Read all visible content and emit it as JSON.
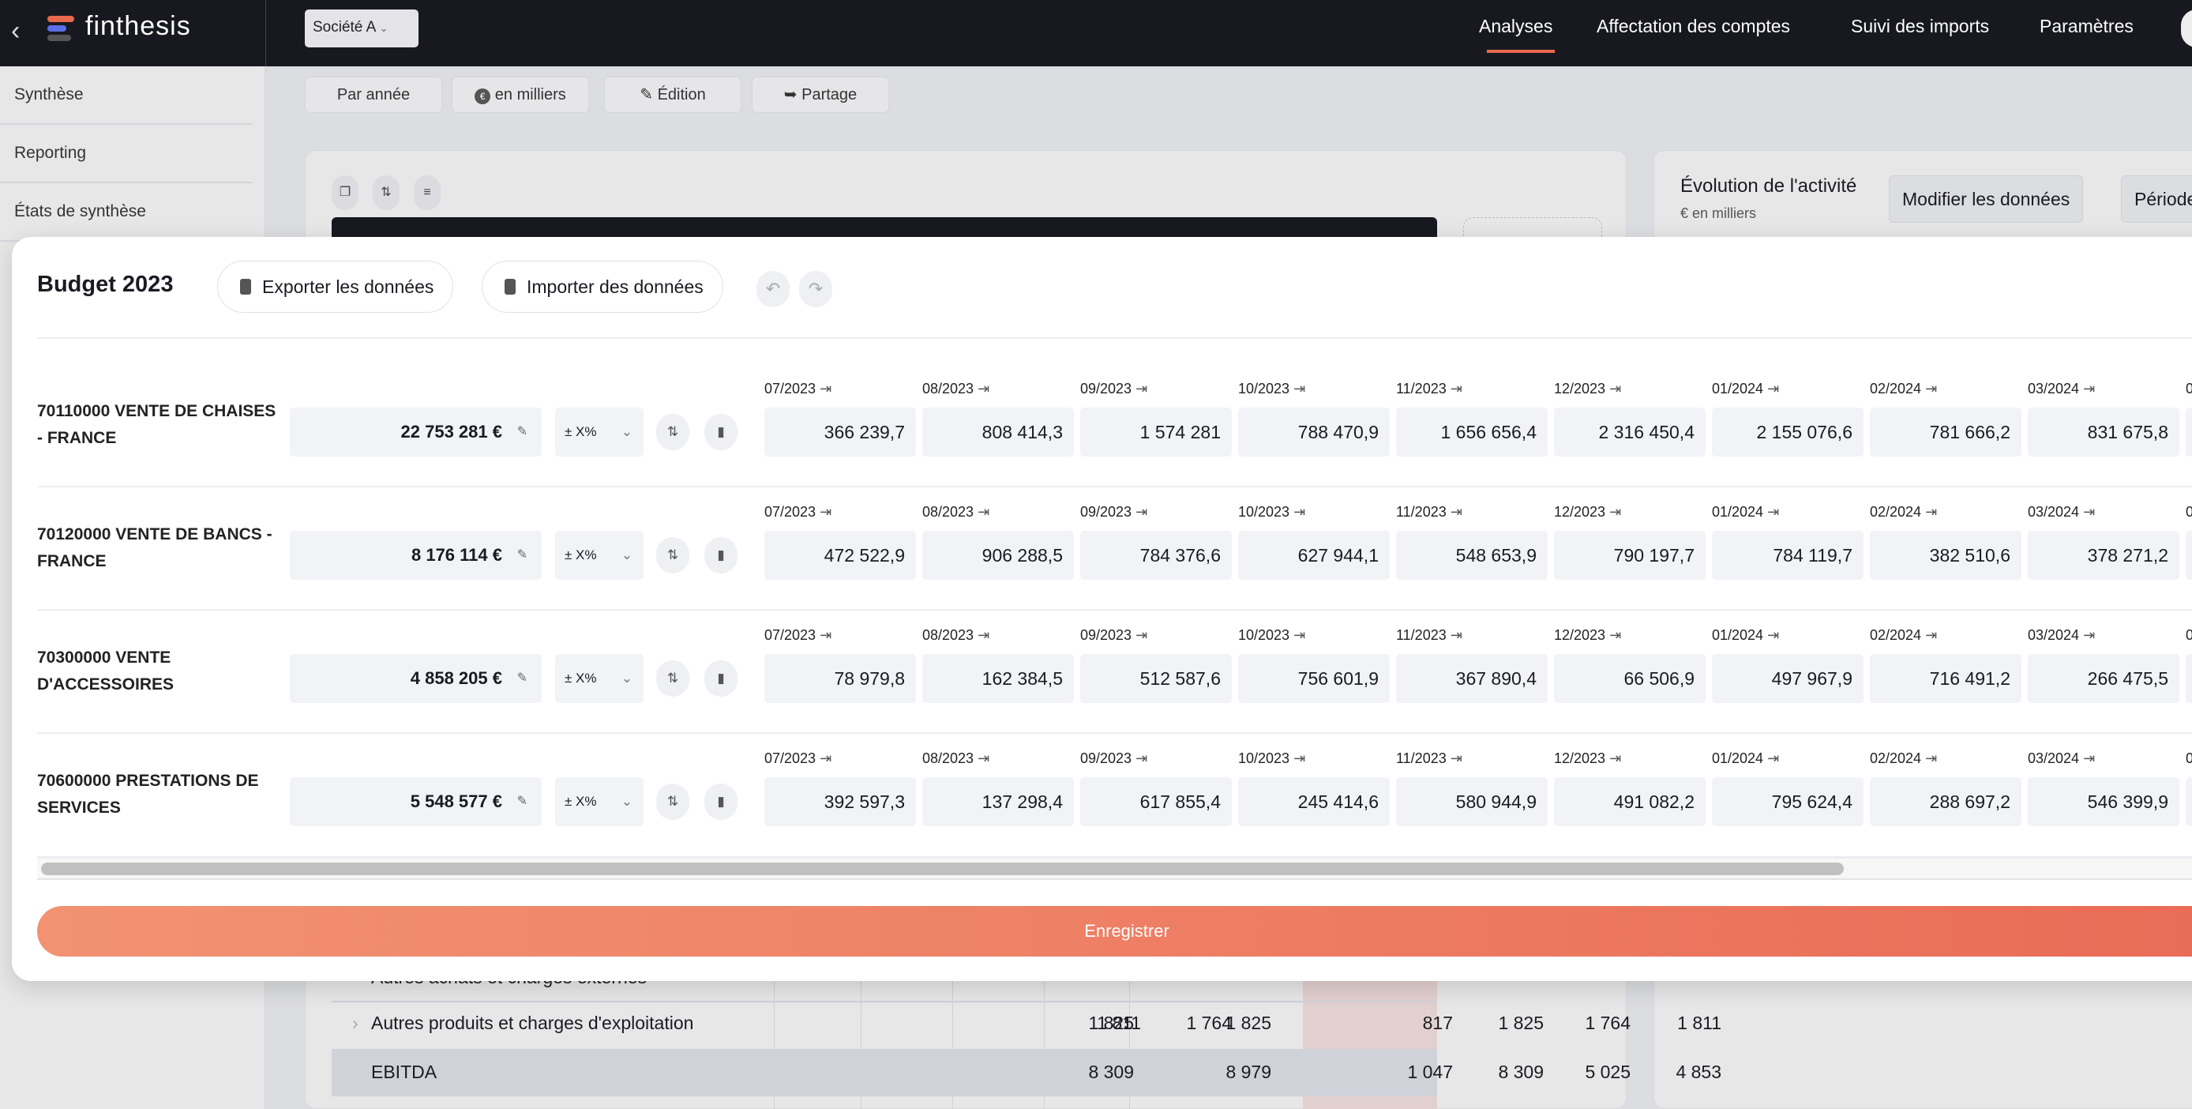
{
  "topbar": {
    "brand": "finthesis",
    "company": "Société A",
    "nav": [
      "Analyses",
      "Affectation des comptes",
      "Suivi des imports",
      "Paramètres"
    ],
    "active_nav": "Analyses",
    "accent": "#e9694f"
  },
  "sidebar": {
    "items": [
      "Synthèse",
      "Reporting",
      "États de synthèse"
    ]
  },
  "toolbar": {
    "buttons": [
      "Par année",
      "en milliers",
      "Édition",
      "Partage"
    ]
  },
  "right_card": {
    "title": "Évolution de l'activité",
    "subtitle": "€ en milliers",
    "modify": "Modifier les données",
    "period": "Période"
  },
  "background_table": {
    "rows": [
      {
        "label": "Autres achats et charges externes"
      },
      {
        "label": "Autres produits et charges d'exploitation",
        "values": [
          "1 811",
          "1 764",
          "1 825",
          "817",
          "1 825",
          "1 825"
        ]
      },
      {
        "label": "EBITDA",
        "values": [
          "4 853",
          "5 025",
          "8 309",
          "1 047",
          "8 979",
          "8 309"
        ]
      }
    ]
  },
  "modal": {
    "title": "Budget 2023",
    "export": "Exporter les données",
    "import": "Importer des données",
    "percent_label": "± X%",
    "save": "Enregistrer",
    "months": [
      "07/2023",
      "08/2023",
      "09/2023",
      "10/2023",
      "11/2023",
      "12/2023",
      "01/2024",
      "02/2024",
      "03/2024"
    ],
    "accounts": [
      {
        "name": "70110000 VENTE DE CHAISES - FRANCE",
        "total": "22 753 281 €",
        "values": [
          "366 239,7",
          "808 414,3",
          "1 574 281",
          "788 470,9",
          "1 656 656,4",
          "2 316 450,4",
          "2 155 076,6",
          "781 666,2",
          "831 675,8"
        ]
      },
      {
        "name": "70120000 VENTE DE BANCS - FRANCE",
        "total": "8 176 114 €",
        "values": [
          "472 522,9",
          "906 288,5",
          "784 376,6",
          "627 944,1",
          "548 653,9",
          "790 197,7",
          "784 119,7",
          "382 510,6",
          "378 271,2"
        ]
      },
      {
        "name": "70300000 VENTE D'ACCESSOIRES",
        "total": "4 858 205 €",
        "values": [
          "78 979,8",
          "162 384,5",
          "512 587,6",
          "756 601,9",
          "367 890,4",
          "66 506,9",
          "497 967,9",
          "716 491,2",
          "266 475,5"
        ]
      },
      {
        "name": "70600000 PRESTATIONS DE SERVICES",
        "total": "5 548 577 €",
        "values": [
          "392 597,3",
          "137 298,4",
          "617 855,4",
          "245 414,6",
          "580 944,9",
          "491 082,2",
          "795 624,4",
          "288 697,2",
          "546 399,9"
        ]
      }
    ]
  }
}
